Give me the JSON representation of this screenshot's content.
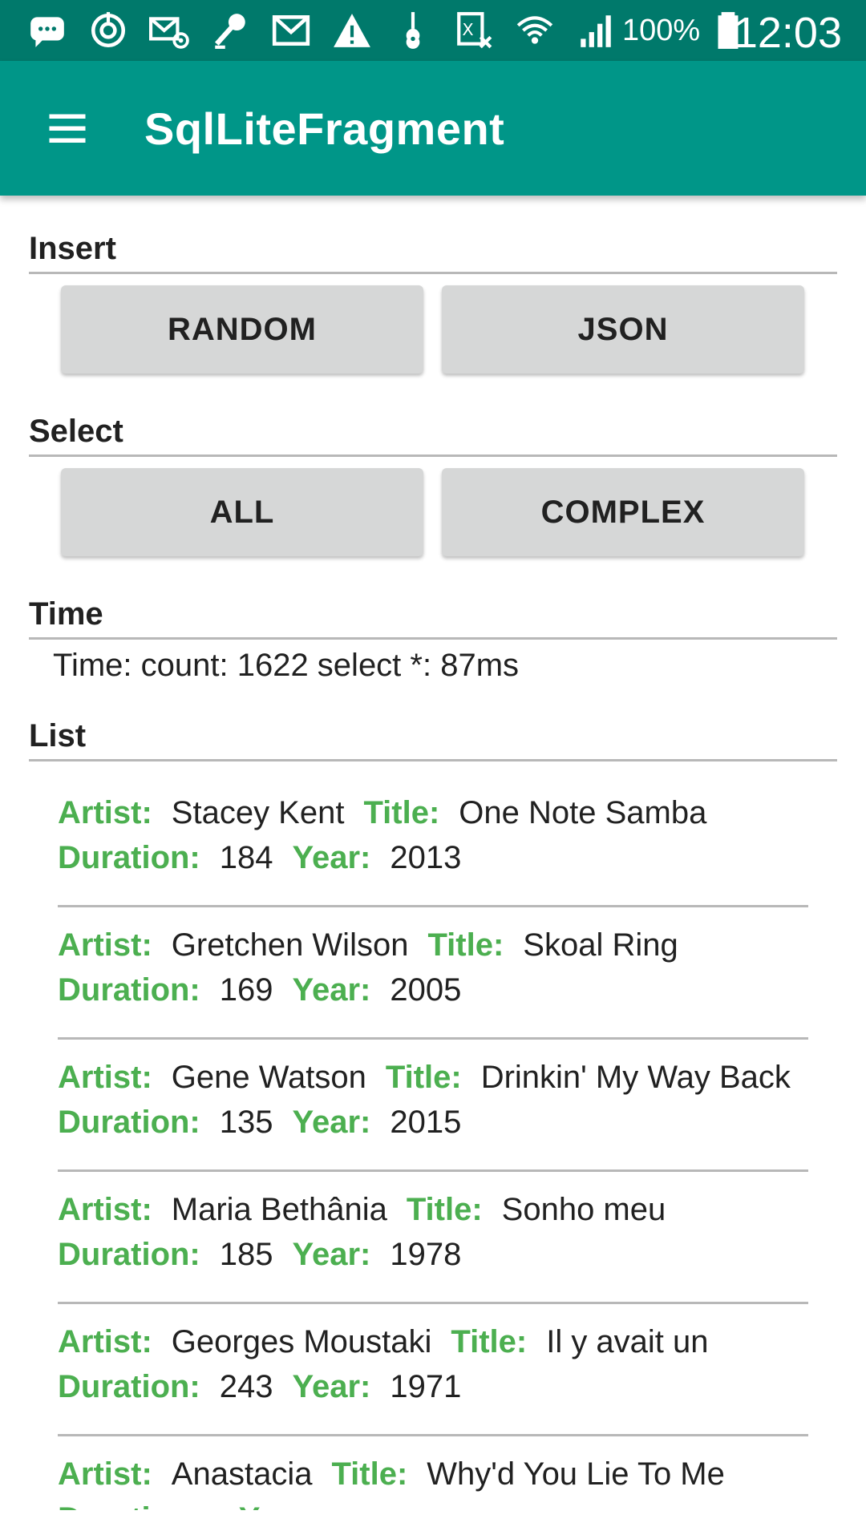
{
  "status_bar": {
    "battery_percent": "100%",
    "clock": "12:03",
    "icons": [
      "message-icon",
      "sync-icon",
      "email-at-icon",
      "microphone-icon",
      "gmail-icon",
      "warning-icon",
      "guitar-icon",
      "excel-icon",
      "wifi-icon",
      "signal-icon",
      "battery-icon"
    ]
  },
  "app_bar": {
    "title": "SqlLiteFragment"
  },
  "sections": {
    "insert": {
      "title": "Insert",
      "buttons": [
        "RANDOM",
        "JSON"
      ]
    },
    "select": {
      "title": "Select",
      "buttons": [
        "ALL",
        "COMPLEX"
      ]
    },
    "time": {
      "title": "Time",
      "text": "Time: count: 1622 select *: 87ms"
    },
    "list": {
      "title": "List"
    }
  },
  "labels": {
    "artist": "Artist:",
    "title": "Title:",
    "duration": "Duration:",
    "year": "Year:"
  },
  "songs": [
    {
      "artist": "Stacey Kent",
      "title": "One Note Samba",
      "duration": "184",
      "year": "2013"
    },
    {
      "artist": "Gretchen Wilson",
      "title": "Skoal Ring",
      "duration": "169",
      "year": "2005"
    },
    {
      "artist": "Gene Watson",
      "title": "Drinkin' My Way Back",
      "duration": "135",
      "year": "2015"
    },
    {
      "artist": "Maria Bethânia",
      "title": "Sonho meu",
      "duration": "185",
      "year": "1978"
    },
    {
      "artist": "Georges Moustaki",
      "title": "Il y avait un",
      "duration": "243",
      "year": "1971"
    },
    {
      "artist": "Anastacia",
      "title": "Why'd You Lie To Me",
      "duration": "",
      "year": ""
    }
  ],
  "colors": {
    "status_bar": "#00796b",
    "app_bar": "#009688",
    "label_green": "#4caf50",
    "button_bg": "#d6d7d7"
  }
}
